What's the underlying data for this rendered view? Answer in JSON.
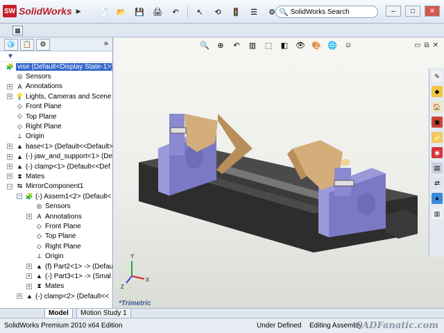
{
  "app": {
    "logo_text": "SolidWorks",
    "search_placeholder": "SolidWorks Search"
  },
  "tree": {
    "items": [
      {
        "label": "vise  (Default<Display State-1>)",
        "level": 0,
        "icon": "assembly-icon",
        "selected": true
      },
      {
        "label": "Sensors",
        "level": 1,
        "icon": "sensors-icon"
      },
      {
        "label": "Annotations",
        "level": 1,
        "icon": "annotations-icon",
        "expander": "+"
      },
      {
        "label": "Lights, Cameras and Scene",
        "level": 1,
        "icon": "lights-icon",
        "expander": "+"
      },
      {
        "label": "Front Plane",
        "level": 1,
        "icon": "plane-icon"
      },
      {
        "label": "Top Plane",
        "level": 1,
        "icon": "plane-icon"
      },
      {
        "label": "Right Plane",
        "level": 1,
        "icon": "plane-icon"
      },
      {
        "label": "Origin",
        "level": 1,
        "icon": "origin-icon"
      },
      {
        "label": "base<1> (Default<<Default>",
        "level": 1,
        "icon": "part-icon",
        "expander": "+"
      },
      {
        "label": "(-) jaw_and_support<1> (Def",
        "level": 1,
        "icon": "part-icon",
        "expander": "+"
      },
      {
        "label": "(-) clamp<1> (Default<<Def",
        "level": 1,
        "icon": "part-icon",
        "expander": "+"
      },
      {
        "label": "Mates",
        "level": 1,
        "icon": "mates-icon",
        "expander": "+"
      },
      {
        "label": "MirrorComponent1",
        "level": 1,
        "icon": "mirror-icon",
        "expander": "−"
      },
      {
        "label": "(-) Assem1<2> (Default<",
        "level": 2,
        "icon": "assembly-icon",
        "expander": "−"
      },
      {
        "label": "Sensors",
        "level": 3,
        "icon": "sensors-icon"
      },
      {
        "label": "Annotations",
        "level": 3,
        "icon": "annotations-icon",
        "expander": "+"
      },
      {
        "label": "Front Plane",
        "level": 3,
        "icon": "plane-icon"
      },
      {
        "label": "Top Plane",
        "level": 3,
        "icon": "plane-icon"
      },
      {
        "label": "Right Plane",
        "level": 3,
        "icon": "plane-icon"
      },
      {
        "label": "Origin",
        "level": 3,
        "icon": "origin-icon"
      },
      {
        "label": "(f) Part2<1> -> (Defau",
        "level": 3,
        "icon": "part-icon",
        "expander": "+"
      },
      {
        "label": "(-) Part3<1> -> (Smal",
        "level": 3,
        "icon": "part-icon",
        "expander": "+"
      },
      {
        "label": "Mates",
        "level": 3,
        "icon": "mates-icon",
        "expander": "+"
      },
      {
        "label": "(-) clamp<2> (Default<<",
        "level": 2,
        "icon": "part-icon",
        "expander": "+"
      }
    ]
  },
  "tabs": {
    "model": "Model",
    "motion": "Motion Study 1"
  },
  "viewport": {
    "view_label": "*Trimetric",
    "axis_x": "X",
    "axis_y": "Y",
    "axis_z": "Z"
  },
  "status": {
    "edition": "SolidWorks Premium 2010 x64 Edition",
    "definition": "Under Defined",
    "mode": "Editing Assembly",
    "watermark": "CADFanatic.com"
  },
  "colors": {
    "accent": "#3366cc",
    "model_body": "#9a98d6",
    "model_base": "#2f2f2f",
    "model_jaw": "#d2ae7c"
  }
}
